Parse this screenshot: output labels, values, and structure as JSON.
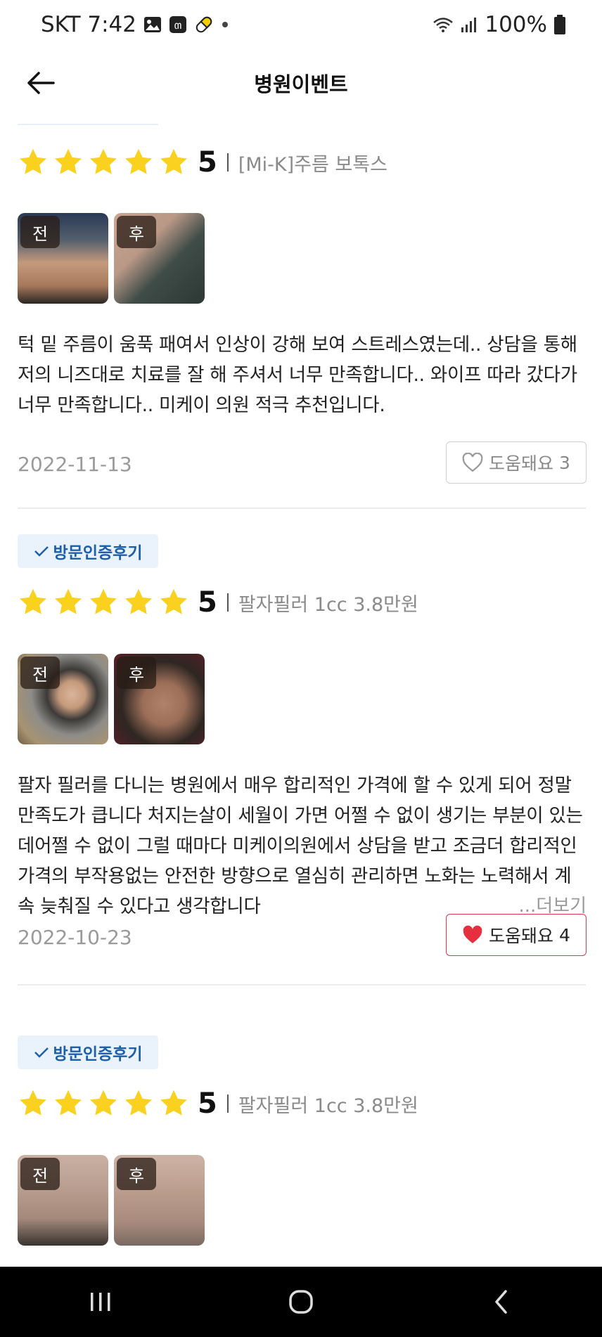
{
  "status_bar": {
    "carrier_time": "SKT 7:42",
    "notification_icons": [
      "image-icon",
      "app-notification-icon",
      "pill-icon",
      "dot-icon"
    ],
    "battery": "100%"
  },
  "header": {
    "title": "병원이벤트",
    "back_icon": "arrow-left-icon"
  },
  "colors": {
    "star": "#F9D11E",
    "badge_bg": "#EAF3FC",
    "badge_text": "#1D5FA8",
    "heart_active": "#E6303F",
    "muted_text": "#9A9A9A"
  },
  "reviews": [
    {
      "badge": "",
      "rating": "5",
      "stars": 5,
      "product": "[Mi-K]주름 보톡스",
      "photo_labels": [
        "전",
        "후"
      ],
      "text": "턱 밑 주름이 움푹 패여서 인상이 강해 보여 스트레스였는데.. 상담을 통해 저의 니즈대로 치료를 잘 해 주셔서 너무 만족합니다.. 와이프 따라 갔다가 너무 만족합니다.. 미케이 의원 적극 추천입니다.",
      "date": "2022-11-13",
      "helpful_label": "도움돼요",
      "helpful_count": "3",
      "liked": false
    },
    {
      "badge": "방문인증후기",
      "rating": "5",
      "stars": 5,
      "product": "팔자필러 1cc 3.8만원",
      "photo_labels": [
        "전",
        "후"
      ],
      "text": "팔자 필러를 다니는 병원에서 매우 합리적인 가격에 할 수 있게 되어 정말 만족도가 큽니다 처지는살이 세월이 가면 어쩔 수 없이 생기는 부분이 있는데어쩔 수 없이 그럴 때마다 미케이의원에서 상담을 받고 조금더 합리적인 가격의 부작용없는 안전한 방향으로 열심히 관리하면 노화는 노력해서 계속 늦춰질 수 있다고 생각합니다",
      "more_label": "...더보기",
      "date": "2022-10-23",
      "helpful_label": "도움돼요",
      "helpful_count": "4",
      "liked": true
    },
    {
      "badge": "방문인증후기",
      "rating": "5",
      "stars": 5,
      "product": "팔자필러 1cc 3.8만원",
      "photo_labels": [
        "전",
        "후"
      ]
    }
  ],
  "nav_bar": {
    "buttons": [
      "recent-apps-icon",
      "home-icon",
      "back-icon"
    ]
  }
}
